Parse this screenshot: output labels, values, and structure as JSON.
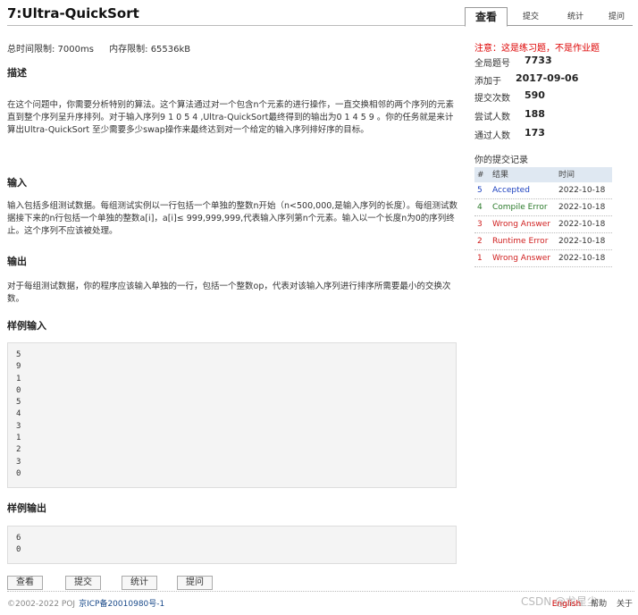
{
  "problem": {
    "title": "7:Ultra-QuickSort",
    "time_limit": "总时间限制: 7000ms",
    "memory_limit": "内存限制: 65536kB",
    "desc_heading": "描述",
    "desc_text": "在这个问题中，你需要分析特别的算法。这个算法通过对一个包含n个元素的进行操作，一直交换相邻的两个序列的元素直到整个序列呈升序排列。对于输入序列9 1 0 5 4 ,Ultra-QuickSort最终得到的输出为0 1 4 5 9 。你的任务就是来计算出Ultra-QuickSort 至少需要多少swap操作来最终达到对一个给定的输入序列排好序的目标。",
    "input_heading": "输入",
    "input_text": "输入包括多组测试数据。每组测试实例以一行包括一个单独的整数n开始（n<500,000,是输入序列的长度）。每组测试数据接下来的n行包括一个单独的整数a[i]，a[i]≤ 999,999,999,代表输入序列第n个元素。输入以一个长度n为0的序列终止。这个序列不应该被处理。",
    "output_heading": "输出",
    "output_text": "对于每组测试数据，你的程序应该输入单独的一行，包括一个整数op，代表对该输入序列进行排序所需要最小的交换次数。",
    "sample_input_heading": "样例输入",
    "sample_input": [
      "5",
      "9",
      "1",
      "0",
      "5",
      "4",
      "3",
      "1",
      "2",
      "3",
      "0"
    ],
    "sample_output_heading": "样例输出",
    "sample_output": [
      "6",
      "0"
    ]
  },
  "tabs": [
    "查看",
    "提交",
    "统计",
    "提问"
  ],
  "buttons": [
    "查看",
    "提交",
    "统计",
    "提问"
  ],
  "sidebar": {
    "notice": "注意：这是练习题，不是作业题",
    "stats": [
      {
        "label": "全局题号",
        "value": "7733"
      },
      {
        "label": "添加于",
        "value": "2017-09-06"
      },
      {
        "label": "提交次数",
        "value": "590"
      },
      {
        "label": "尝试人数",
        "value": "188"
      },
      {
        "label": "通过人数",
        "value": "173"
      }
    ],
    "records_title": "你的提交记录",
    "records_headers": [
      "#",
      "结果",
      "时间"
    ],
    "records": [
      {
        "id": "5",
        "result": "Accepted",
        "time": "2022-10-18",
        "color": "#1a3fbf"
      },
      {
        "id": "4",
        "result": "Compile Error",
        "time": "2022-10-18",
        "color": "#2a7a2a"
      },
      {
        "id": "3",
        "result": "Wrong Answer",
        "time": "2022-10-18",
        "color": "#d02020"
      },
      {
        "id": "2",
        "result": "Runtime Error",
        "time": "2022-10-18",
        "color": "#d02020"
      },
      {
        "id": "1",
        "result": "Wrong Answer",
        "time": "2022-10-18",
        "color": "#d02020"
      }
    ]
  },
  "footer": {
    "copyright": "©2002-2022 POJ",
    "icp": "京ICP备20010980号-1",
    "english": "English",
    "help": "帮助",
    "about": "关于"
  },
  "watermark": "CSDN @龙星尘"
}
